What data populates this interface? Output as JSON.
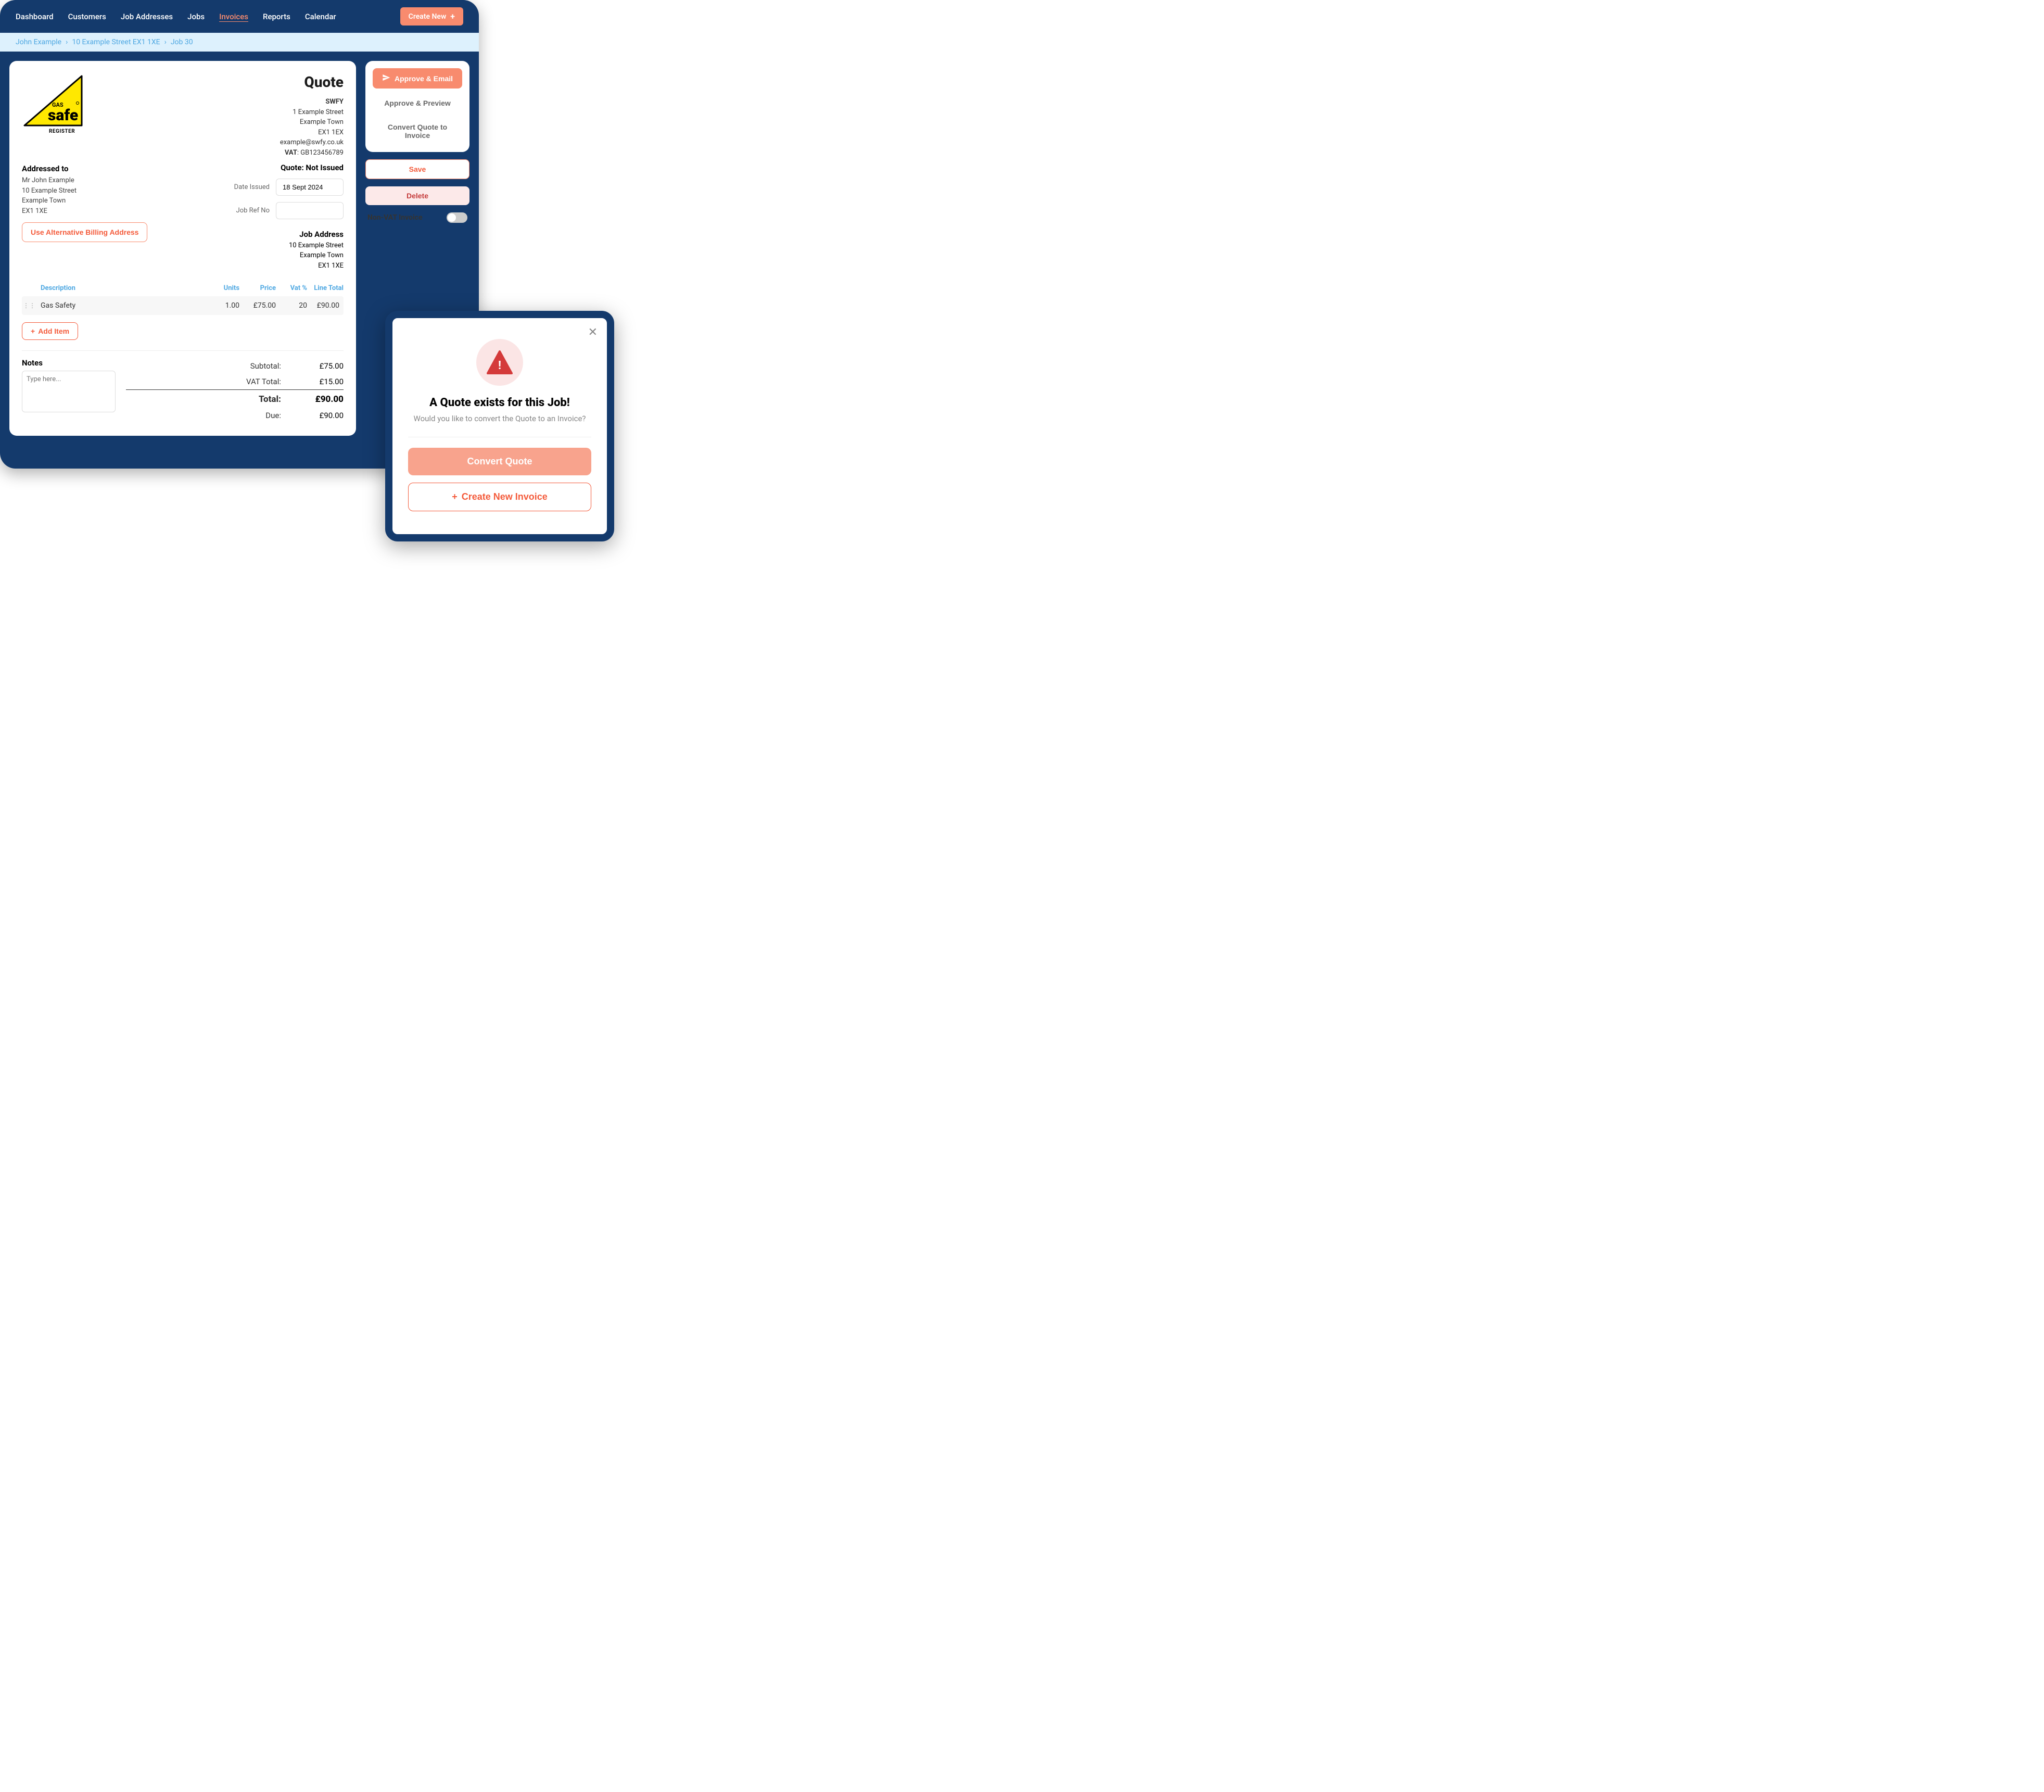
{
  "nav": {
    "items": [
      "Dashboard",
      "Customers",
      "Job Addresses",
      "Jobs",
      "Invoices",
      "Reports",
      "Calendar"
    ],
    "active_index": 4,
    "create_label": "Create New"
  },
  "breadcrumb": {
    "items": [
      "John Example",
      "10 Example Street EX1 1XE",
      "Job 30"
    ]
  },
  "quote": {
    "title": "Quote",
    "company": {
      "name": "SWFY",
      "line1": "1 Example Street",
      "line2": "Example Town",
      "postcode": "EX1 1EX",
      "email": "example@swfy.co.uk",
      "vat_label": "VAT",
      "vat": ": GB123456789"
    },
    "addressed": {
      "title": "Addressed to",
      "name": "Mr John Example",
      "line1": "10 Example Street",
      "line2": "Example Town",
      "postcode": "EX1 1XE"
    },
    "alt_addr_btn": "Use Alternative Billing Address",
    "status": "Quote: Not Issued",
    "date_label": "Date Issued",
    "date_value": "18 Sept 2024",
    "ref_label": "Job Ref No",
    "ref_value": "",
    "job_addr": {
      "title": "Job Address",
      "line1": "10 Example Street",
      "line2": "Example Town",
      "postcode": "EX1 1XE"
    }
  },
  "table": {
    "headers": {
      "desc": "Description",
      "units": "Units",
      "price": "Price",
      "vat": "Vat %",
      "total": "Line Total"
    },
    "rows": [
      {
        "desc": "Gas Safety",
        "units": "1.00",
        "price": "£75.00",
        "vat": "20",
        "total": "£90.00"
      }
    ],
    "add_label": "Add Item"
  },
  "notes": {
    "title": "Notes",
    "placeholder": "Type here..."
  },
  "totals": {
    "subtotal_label": "Subtotal:",
    "subtotal": "£75.00",
    "vat_label": "VAT Total:",
    "vat": "£15.00",
    "total_label": "Total:",
    "total": "£90.00",
    "due_label": "Due:",
    "due": "£90.00"
  },
  "side": {
    "approve_email": "Approve & Email",
    "approve_preview": "Approve & Preview",
    "convert": "Convert Quote to Invoice",
    "save": "Save",
    "delete": "Delete",
    "nonvat_label": "Non-VAT Invoice"
  },
  "modal": {
    "title": "A Quote exists for this Job!",
    "sub": "Would you like to convert the Quote to an Invoice?",
    "convert": "Convert Quote",
    "create": "Create New Invoice"
  },
  "logo": {
    "gas": "GAS",
    "safe": "safe",
    "register": "REGISTER"
  }
}
